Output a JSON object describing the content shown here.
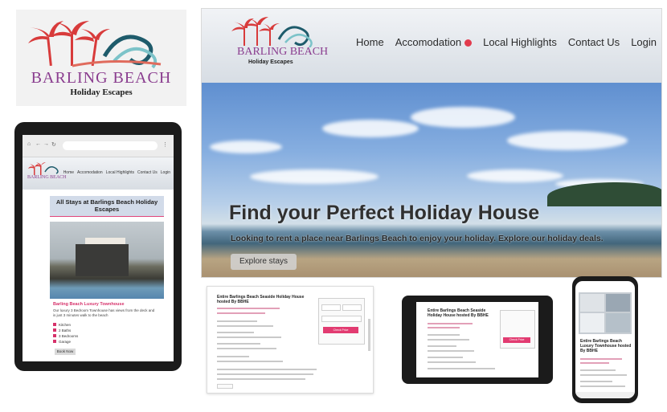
{
  "logo": {
    "name": "BARLING BEACH",
    "tagline": "Holiday Escapes"
  },
  "desktop": {
    "nav": [
      "Home",
      "Accomodation",
      "Local Highlights",
      "Contact Us",
      "Login"
    ],
    "logo_name": "BARLING BEACH",
    "logo_tagline": "Holiday Escapes",
    "hero_title": "Find your Perfect Holiday House",
    "hero_subtitle": "Looking to rent a place near Barlings Beach to enjoy your holiday. Explore our holiday deals.",
    "cta_label": "Explore stays"
  },
  "tablet": {
    "nav": [
      "Home",
      "Accomodation",
      "Local Highlights",
      "Contact Us",
      "Login"
    ],
    "logo_name": "BARLING BEACH",
    "card_title": "All Stays at Barlings Beach Holiday Escapes",
    "listing_title": "Barling Beach Luxury Townhouse",
    "listing_desc": "Our luxury 3 Bedroom Townhouse has views from the deck and is just 3 minutes walk to the beach",
    "amenities": [
      "Kitchen",
      "2 Baths",
      "3 Bedrooms",
      "Garage"
    ],
    "button": "Book Now"
  },
  "laptop": {
    "title": "Entire Barlings Beach Seaside Holiday House hosted By BBHE",
    "button": "Check Price"
  },
  "tablet2": {
    "title": "Entire Barlings Beach Seaside Holiday House hosted By BBHE",
    "button": "Check Price"
  },
  "phone": {
    "title": "Entire Barlings Beach Luxury Townhouse hosted By BBHE"
  },
  "colors": {
    "brand_purple": "#8a3d8f",
    "accent_pink": "#e23b71",
    "nav_dot": "#e23b4d"
  }
}
